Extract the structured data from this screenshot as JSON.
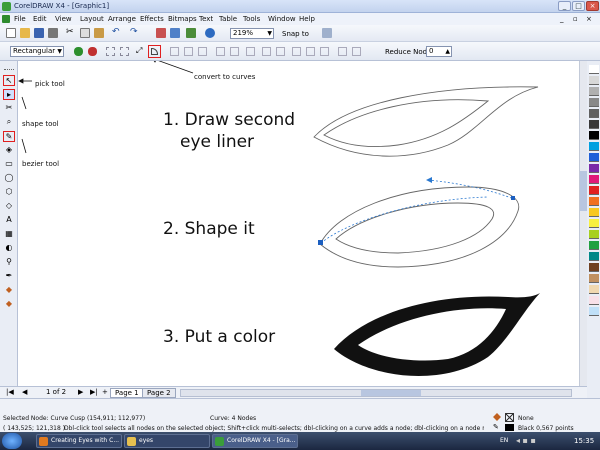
{
  "window": {
    "title": "CorelDRAW X4 - [Graphic1]"
  },
  "menu": [
    "File",
    "Edit",
    "View",
    "Layout",
    "Arrange",
    "Effects",
    "Bitmaps",
    "Text",
    "Table",
    "Tools",
    "Window",
    "Help"
  ],
  "toolbar": {
    "zoom": "219%",
    "snap_to": "Snap to"
  },
  "propbar": {
    "node_mode": "Rectangular",
    "reduce_nodes_label": "Reduce Nodes",
    "reduce_nodes_value": "0"
  },
  "canvas": {
    "steps": [
      "1. Draw second",
      "eye liner",
      "2. Shape it",
      "3. Put a color"
    ],
    "annotations": {
      "pick_tool": "pick tool",
      "shape_tool": "shape tool",
      "bezier_tool": "bezier tool",
      "convert_to_curves": "convert to curves"
    }
  },
  "pages": {
    "counter": "1 of 2",
    "tabs": [
      "Page 1",
      "Page 2"
    ]
  },
  "status": {
    "selected": "Selected Node: Curve Cusp (154,911; 112,977)",
    "curve": "Curve: 4 Nodes",
    "coords": "( 143,525; 121,318 )",
    "hint": "Dbl-click tool selects all nodes on the selected object; Shift+click multi-selects; dbl-clicking on a curve adds a node; dbl-clicking on a node removes it",
    "fill": "None",
    "outline": "Black  0,567 points"
  },
  "taskbar": {
    "tasks": [
      "Creating Eyes with C...",
      "eyes",
      "CorelDRAW X4 - [Gra..."
    ],
    "lang": "EN",
    "time": "15:35"
  },
  "colors": {
    "palette": [
      "#ffffff",
      "#d8d8d8",
      "#b0b0b0",
      "#888888",
      "#606060",
      "#383838",
      "#000000",
      "#00a0e0",
      "#1e5fd8",
      "#7a2aa8",
      "#e01878",
      "#e02020",
      "#f07020",
      "#f8c820",
      "#f8f040",
      "#a8d020",
      "#20a040",
      "#008888",
      "#704020",
      "#c09060",
      "#f0d8b0",
      "#f8e0e8",
      "#c0e0f8"
    ]
  }
}
